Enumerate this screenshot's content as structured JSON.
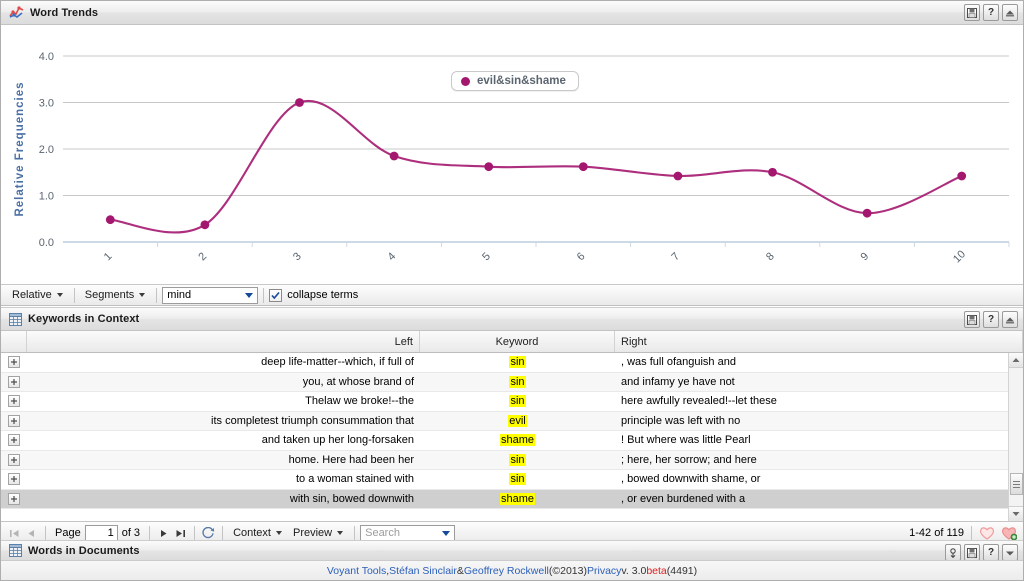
{
  "window": {
    "title": "Word Trends",
    "title_icon": "trend-chart-icon",
    "tools": [
      {
        "name": "save-icon",
        "label": "Save"
      },
      {
        "name": "help-icon",
        "label": "?"
      },
      {
        "name": "collapse-up-icon",
        "label": "Collapse"
      }
    ]
  },
  "chart_data": {
    "type": "line",
    "title": "",
    "xlabel": "",
    "ylabel": "Relative Frequencies",
    "categories": [
      "1",
      "2",
      "3",
      "4",
      "5",
      "6",
      "7",
      "8",
      "9",
      "10"
    ],
    "series": [
      {
        "name": "evil&sin&shame",
        "color": "#a4176f",
        "values": [
          0.48,
          0.37,
          3.0,
          1.85,
          1.62,
          1.62,
          1.42,
          1.5,
          0.62,
          1.42
        ]
      }
    ],
    "ylim": [
      0.0,
      4.0
    ],
    "yticks": [
      "0.0",
      "1.0",
      "2.0",
      "3.0",
      "4.0"
    ],
    "grid": true,
    "legend_position": "top-center",
    "smoothing": "spline",
    "axis_label_color": "#4a6fa5",
    "tick_color": "#5b6570"
  },
  "chart_toolbar": {
    "scale_menu": "Relative",
    "segments_menu": "Segments",
    "term_combo_value": "mind",
    "collapse_terms_label": "collapse terms",
    "collapse_terms_checked": true
  },
  "kwic": {
    "title": "Keywords in Context",
    "title_icon": "table-grid-icon",
    "tools": [
      {
        "name": "save-icon",
        "label": "Save"
      },
      {
        "name": "help-icon",
        "label": "?"
      },
      {
        "name": "collapse-up-icon",
        "label": "Collapse"
      }
    ],
    "columns": [
      "Left",
      "Keyword",
      "Right"
    ],
    "rows": [
      {
        "left": "deep life-matter--which, if full of",
        "keyword": "sin",
        "right": ", was full ofanguish and",
        "selected": false
      },
      {
        "left": "you, at whose brand of",
        "keyword": "sin",
        "right": "and infamy ye have not",
        "selected": false
      },
      {
        "left": "Thelaw we broke!--the",
        "keyword": "sin",
        "right": "here awfully revealed!--let these",
        "selected": false
      },
      {
        "left": "its completest triumph consummation that",
        "keyword": "evil",
        "right": "principle was left with no",
        "selected": false
      },
      {
        "left": "and taken up her long-forsaken",
        "keyword": "shame",
        "right": "! But where was little Pearl",
        "selected": false
      },
      {
        "left": "home. Here had been her",
        "keyword": "sin",
        "right": "; here, her sorrow; and here",
        "selected": false
      },
      {
        "left": "to a woman stained with",
        "keyword": "sin",
        "right": ", bowed downwith shame, or",
        "selected": false
      },
      {
        "left": "with sin, bowed downwith",
        "keyword": "shame",
        "right": ", or even burdened with a",
        "selected": true
      }
    ],
    "highlight_color": "#ffff00"
  },
  "pager": {
    "first_label": "First",
    "prev_label": "Previous",
    "page_label": "Page",
    "page_value": "1",
    "of_label": "of 3",
    "next_label": "Next",
    "last_label": "Last",
    "refresh_label": "Refresh",
    "context_menu": "Context",
    "preview_menu": "Preview",
    "search_placeholder": "Search",
    "search_value": "",
    "result_count": "1-42 of 119",
    "heart_icon": "heart-icon",
    "heart_add_icon": "heart-add-icon"
  },
  "words_in_documents": {
    "title": "Words in Documents",
    "title_icon": "table-grid-icon",
    "tools": [
      {
        "name": "export-icon",
        "label": "Export"
      },
      {
        "name": "save-icon",
        "label": "Save"
      },
      {
        "name": "help-icon",
        "label": "?"
      },
      {
        "name": "expand-down-icon",
        "label": "Expand"
      }
    ]
  },
  "footer": {
    "tool_name": "Voyant Tools",
    "separator_1": ", ",
    "author_1": "Stéfan Sinclair",
    "amp": " & ",
    "author_2": "Geoffrey Rockwell",
    "copyright": " (©2013) ",
    "privacy": "Privacy",
    "version": " v. 3.0 ",
    "beta": "beta",
    "build": " (4491)"
  }
}
